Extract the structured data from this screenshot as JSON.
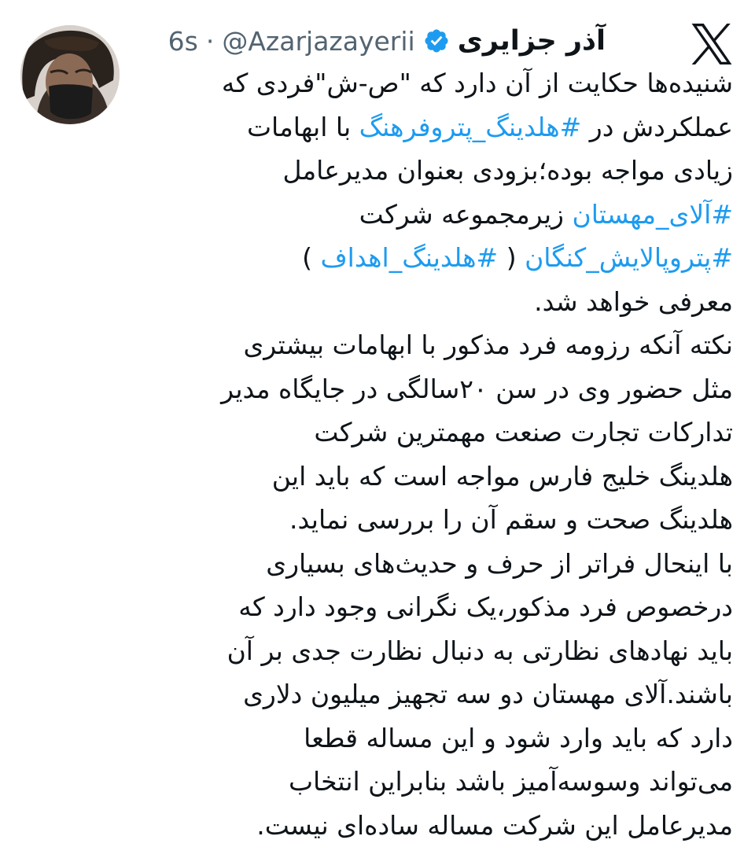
{
  "tweet": {
    "author": {
      "display_name": "آذر جزایری",
      "handle": "@Azarjazayerii",
      "verified_icon": "verified-badge-icon",
      "avatar": "avatar-image"
    },
    "separator": "·",
    "timestamp": "6s",
    "platform_logo": "x-logo-icon",
    "colors": {
      "text": "#0f1419",
      "secondary": "#536471",
      "link": "#1d9bf0",
      "verified": "#1d9bf0",
      "background": "#ffffff"
    },
    "body": {
      "l1": "شنیده‌ها حکایت از آن دارد که \"ص-ش\"فردی که",
      "l2a": "عملکردش در ",
      "l2_tag": "#هلدینگ_پتروفرهنگ",
      "l2b": " با ابهامات",
      "l3": "زیادی مواجه بوده؛بزودی بعنوان مدیرعامل",
      "l4_tag": "#آلای_مهستان",
      "l4b": " زیرمجموعه شرکت",
      "l5_tag1": "#پتروپالایش_کنگان",
      "l5_open": " ( ",
      "l5_tag2": "#هلدینگ_اهداف",
      "l5_close": " )",
      "l6": "معرفی خواهد شد.",
      "l7": "نکته آنکه رزومه فرد مذکور با ابهامات بیشتری",
      "l8": "مثل حضور وی در سن ۲۰سالگی در جایگاه مدیر",
      "l9": "تدارکات تجارت صنعت مهمترین شرکت",
      "l10": "هلدینگ خلیج فارس مواجه است که باید این",
      "l11": "هلدینگ صحت و سقم آن را بررسی نماید.",
      "l12": "با اینحال فراتر از حرف و حدیث‌های بسیاری",
      "l13": "درخصوص فرد مذکور،یک نگرانی وجود دارد که",
      "l14": "باید نهادهای نظارتی به دنبال نظارت جدی بر آن",
      "l15": "باشند.آلای مهستان دو سه تجهیز میلیون دلاری",
      "l16": "دارد که باید وارد شود و این مساله قطعا",
      "l17": "می‌تواند وسوسه‌آمیز باشد بنابراین انتخاب",
      "l18": "مدیرعامل این شرکت مساله ساده‌ای نیست."
    }
  }
}
